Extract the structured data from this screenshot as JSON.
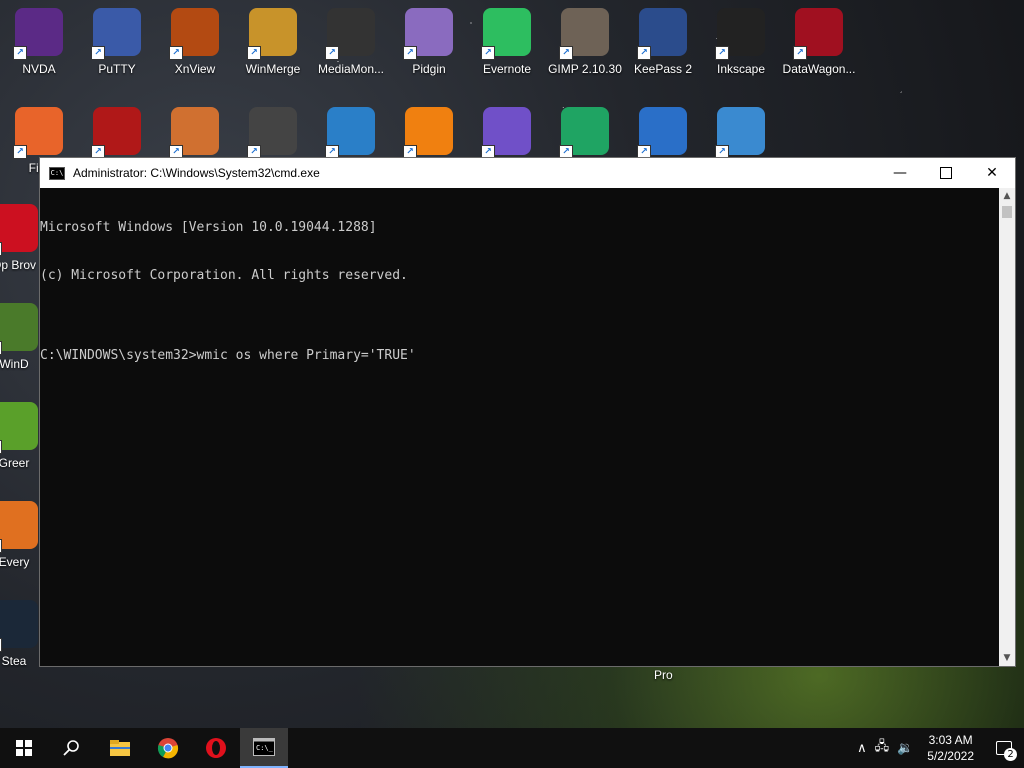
{
  "desktop": {
    "row1": [
      {
        "label": "NVDA",
        "icon": "nvda-icon",
        "color": "#5b2a86"
      },
      {
        "label": "PuTTY",
        "icon": "putty-icon",
        "color": "#3a5aa8"
      },
      {
        "label": "XnView",
        "icon": "xnview-icon",
        "color": "#b34a12"
      },
      {
        "label": "WinMerge",
        "icon": "winmerge-icon",
        "color": "#c8932a"
      },
      {
        "label": "MediaMon...",
        "icon": "mediamonkey-icon",
        "color": "#333333"
      },
      {
        "label": "Pidgin",
        "icon": "pidgin-icon",
        "color": "#8a6bbf"
      },
      {
        "label": "Evernote",
        "icon": "evernote-icon",
        "color": "#2dbe60"
      },
      {
        "label": "GIMP 2.10.30",
        "icon": "gimp-icon",
        "color": "#6e6256"
      },
      {
        "label": "KeePass 2",
        "icon": "keepass-icon",
        "color": "#2b4c8c"
      },
      {
        "label": "Inkscape",
        "icon": "inkscape-icon",
        "color": "#222222"
      },
      {
        "label": "DataWagon...",
        "icon": "datawagon-icon",
        "color": "#a01020"
      }
    ],
    "row2": [
      {
        "label": "",
        "icon": "firefox-icon",
        "color": "#e8642a"
      },
      {
        "label": "",
        "icon": "app-32-icon",
        "color": "#b01818"
      },
      {
        "label": "",
        "icon": "eye-app-icon",
        "color": "#d07030"
      },
      {
        "label": "",
        "icon": "mpc-321-icon",
        "color": "#444444"
      },
      {
        "label": "",
        "icon": "vnc-icon",
        "color": "#2a7fc8"
      },
      {
        "label": "",
        "icon": "vlc-icon",
        "color": "#f08010"
      },
      {
        "label": "",
        "icon": "krita-icon",
        "color": "#7050c8"
      },
      {
        "label": "",
        "icon": "google-drive-icon",
        "color": "#1fa463"
      },
      {
        "label": "",
        "icon": "cd-burner-icon",
        "color": "#2a6fc8"
      },
      {
        "label": "",
        "icon": "remote-desktop-icon",
        "color": "#3a8ad0"
      }
    ],
    "column": [
      {
        "label": "Op Brov",
        "icon": "opera-icon",
        "color": "#cc1020"
      },
      {
        "label": "WinD",
        "icon": "windirstat-icon",
        "color": "#4a7a2a"
      },
      {
        "label": "Greer",
        "icon": "greenshot-icon",
        "color": "#5aa02a"
      },
      {
        "label": "Every",
        "icon": "everything-icon",
        "color": "#e07020"
      },
      {
        "label": "Stea",
        "icon": "steam-icon",
        "color": "#1b2838"
      }
    ],
    "row2_firefox_label": "Fire",
    "pro_label": "Pro"
  },
  "cmd": {
    "title": "Administrator: C:\\Windows\\System32\\cmd.exe",
    "lines": [
      "Microsoft Windows [Version 10.0.19044.1288]",
      "(c) Microsoft Corporation. All rights reserved.",
      "",
      "C:\\WINDOWS\\system32>wmic os where Primary='TRUE'"
    ]
  },
  "taskbar": {
    "time": "3:03 AM",
    "date": "5/2/2022",
    "notification_count": "2"
  }
}
